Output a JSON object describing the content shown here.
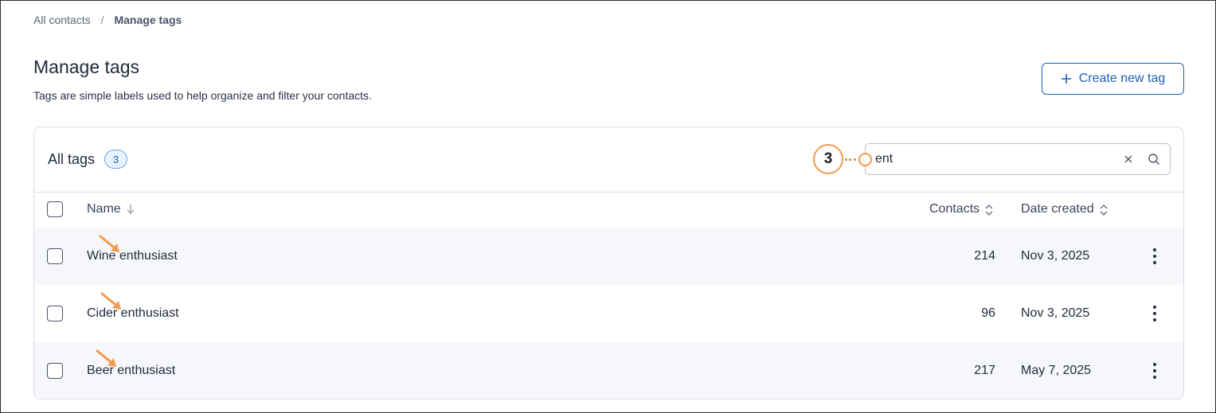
{
  "breadcrumb": {
    "parent": "All contacts",
    "separator": "/",
    "current": "Manage tags"
  },
  "header": {
    "title": "Manage tags",
    "subtitle": "Tags are simple labels used to help organize and filter your contacts.",
    "create_button_label": "Create new tag"
  },
  "tags_card": {
    "title": "All tags",
    "count": "3",
    "search": {
      "value": "ent",
      "clear_icon": "close-icon",
      "search_icon": "magnifier-icon"
    },
    "callout_number": "3",
    "columns": {
      "name": "Name",
      "contacts": "Contacts",
      "date_created": "Date created"
    },
    "rows": [
      {
        "name": "Wine enthusiast",
        "contacts": "214",
        "date_created": "Nov 3, 2025"
      },
      {
        "name": "Cider enthusiast",
        "contacts": "96",
        "date_created": "Nov 3, 2025"
      },
      {
        "name": "Beer enthusiast",
        "contacts": "217",
        "date_created": "May 7, 2025"
      }
    ]
  },
  "colors": {
    "accent": "#1f5fb6",
    "callout": "#f39a4e",
    "row_shade": "#f6f7fa",
    "border": "#d9dde3"
  }
}
